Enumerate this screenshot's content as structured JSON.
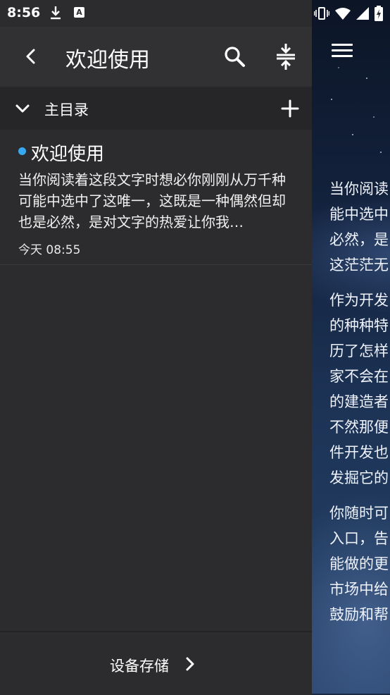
{
  "status_bar": {
    "time": "8:56",
    "icons": [
      "download-icon",
      "a-icon",
      "vibrate-icon",
      "wifi-icon",
      "signal-icon",
      "battery-charging-icon"
    ],
    "a_icon_text": "A"
  },
  "drawer": {
    "title": "欢迎使用",
    "directory": {
      "label": "主目录"
    },
    "notes": [
      {
        "title": "欢迎使用",
        "preview": "当你阅读着这段文字时想必你刚刚从万千种可能中选中了这唯一，这既是一种偶然但却也是必然，是对文字的热爱让你我…",
        "time": "今天 08:55",
        "dot_color": "#38a9f0"
      }
    ],
    "storage_label": "设备存储"
  },
  "reader": {
    "paragraphs": [
      [
        "当你阅读",
        "能中选中",
        "必然，是",
        "这茫茫无"
      ],
      [
        "作为开发",
        "的种种特",
        "历了怎样",
        "家不会在",
        "的建造者",
        "不然那便",
        "件开发也",
        "发掘它的"
      ],
      [
        "你随时可",
        "入口，告",
        "能做的更",
        "市场中给",
        "鼓励和帮"
      ]
    ]
  },
  "colors": {
    "drawer_bg": "#2c2c2e",
    "topbar_bg": "#313133",
    "accent_dot": "#38a9f0"
  }
}
